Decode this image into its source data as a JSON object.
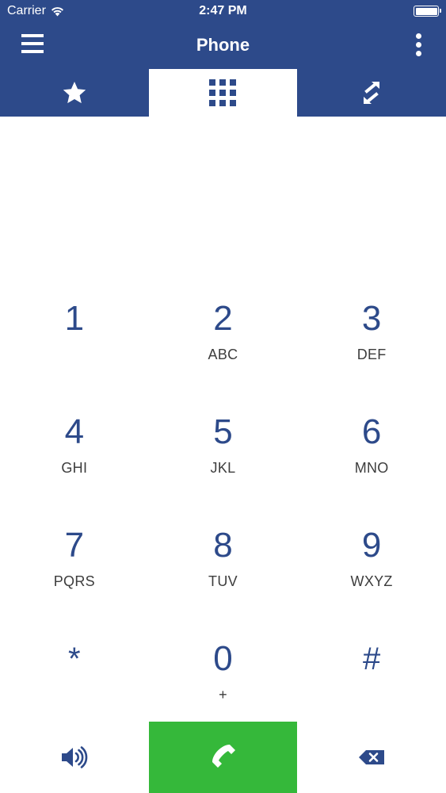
{
  "status_bar": {
    "carrier": "Carrier",
    "time": "2:47 PM",
    "signal_icon": "wifi-icon",
    "battery_icon": "battery-icon"
  },
  "header": {
    "title": "Phone",
    "menu_icon": "hamburger-menu-icon",
    "more_icon": "more-vertical-icon"
  },
  "tabs": [
    {
      "icon": "star-icon",
      "active": false
    },
    {
      "icon": "dialpad-grid-icon",
      "active": true
    },
    {
      "icon": "call-history-arrows-icon",
      "active": false
    }
  ],
  "keypad": {
    "keys": [
      {
        "digit": "1",
        "letters": ""
      },
      {
        "digit": "2",
        "letters": "ABC"
      },
      {
        "digit": "3",
        "letters": "DEF"
      },
      {
        "digit": "4",
        "letters": "GHI"
      },
      {
        "digit": "5",
        "letters": "JKL"
      },
      {
        "digit": "6",
        "letters": "MNO"
      },
      {
        "digit": "7",
        "letters": "PQRS"
      },
      {
        "digit": "8",
        "letters": "TUV"
      },
      {
        "digit": "9",
        "letters": "WXYZ"
      },
      {
        "digit": "*",
        "letters": ""
      },
      {
        "digit": "0",
        "letters": "+"
      },
      {
        "digit": "#",
        "letters": ""
      }
    ]
  },
  "bottom_bar": {
    "speaker_icon": "speaker-icon",
    "call_icon": "phone-call-icon",
    "backspace_icon": "backspace-icon"
  },
  "colors": {
    "brand_blue": "#2d4a8a",
    "call_green": "#35b83a",
    "letters_gray": "#3d3d3d",
    "background": "#ffffff"
  }
}
